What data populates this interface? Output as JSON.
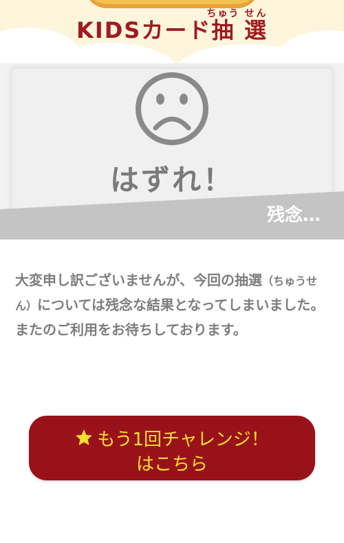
{
  "header": {
    "title_prefix": "KIDSカード",
    "title_kanji_1": "抽",
    "title_kanji_2": "選",
    "title_reading_1": "ちゅう",
    "title_reading_2": "せん"
  },
  "result": {
    "icon": "sad-face-icon",
    "title": "はずれ！",
    "subtitle": "残念…"
  },
  "message": {
    "line_before_ruby": "大変申し訳ございませんが、今回の抽選",
    "ruby_note": "（ちゅうせん）",
    "line_after_ruby": "については残念な結果となってしまいました。",
    "line_2": "またのご利用をお待ちしております。"
  },
  "retry_button": {
    "icon": "star-icon",
    "line_1": "もう1回チャレンジ！",
    "line_2": "はこちら"
  },
  "colors": {
    "title_red": "#a11a22",
    "button_red": "#9a1219",
    "button_text_yellow": "#f6e12c",
    "card_gray": "#f0f0f0",
    "band_gray": "#c4c4c4",
    "text_gray": "#7d7d7d"
  }
}
